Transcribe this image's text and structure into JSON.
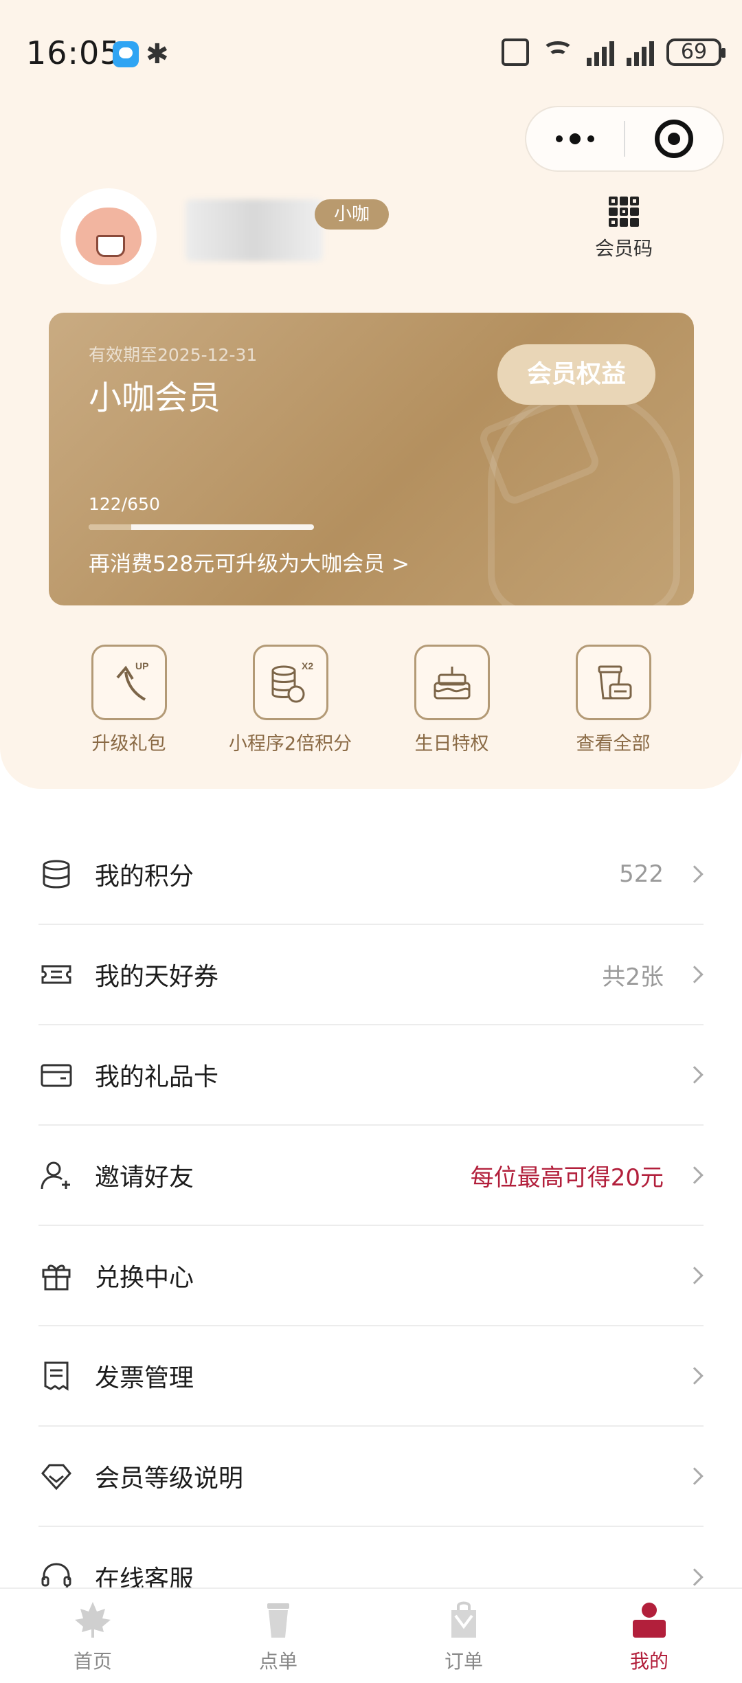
{
  "status_bar": {
    "time": "16:05",
    "battery": "69"
  },
  "profile": {
    "level_badge": "小咖",
    "member_code_label": "会员码"
  },
  "card": {
    "expiry": "有效期至2025-12-31",
    "title": "小咖会员",
    "benefits_button": "会员权益",
    "progress_text": "122/650",
    "progress_fraction": 0.1877,
    "upgrade_text": "再消费528元可升级为大咖会员 >"
  },
  "quick_actions": [
    {
      "label": "升级礼包",
      "icon": "upgrade-arrow-icon"
    },
    {
      "label": "小程序2倍积分",
      "icon": "double-points-icon"
    },
    {
      "label": "生日特权",
      "icon": "birthday-cake-icon"
    },
    {
      "label": "查看全部",
      "icon": "coffee-cup-icon"
    }
  ],
  "menu": [
    {
      "label": "我的积分",
      "value": "522",
      "icon": "database-icon"
    },
    {
      "label": "我的天好券",
      "value": "共2张",
      "icon": "ticket-icon"
    },
    {
      "label": "我的礼品卡",
      "value": "",
      "icon": "wallet-card-icon"
    },
    {
      "label": "邀请好友",
      "value": "每位最高可得20元",
      "icon": "invite-user-icon"
    },
    {
      "label": "兑换中心",
      "value": "",
      "icon": "gift-icon"
    },
    {
      "label": "发票管理",
      "value": "",
      "icon": "receipt-icon"
    },
    {
      "label": "会员等级说明",
      "value": "",
      "icon": "diamond-icon"
    },
    {
      "label": "在线客服",
      "value": "",
      "icon": "headset-icon"
    }
  ],
  "tabs": [
    {
      "label": "首页",
      "icon": "maple-leaf-icon"
    },
    {
      "label": "点单",
      "icon": "cup-icon"
    },
    {
      "label": "订单",
      "icon": "order-bag-icon"
    },
    {
      "label": "我的",
      "icon": "profile-icon"
    }
  ],
  "colors": {
    "accent_red": "#b21f3b",
    "gold": "#b4905f",
    "background_top": "#fdf4ea"
  }
}
